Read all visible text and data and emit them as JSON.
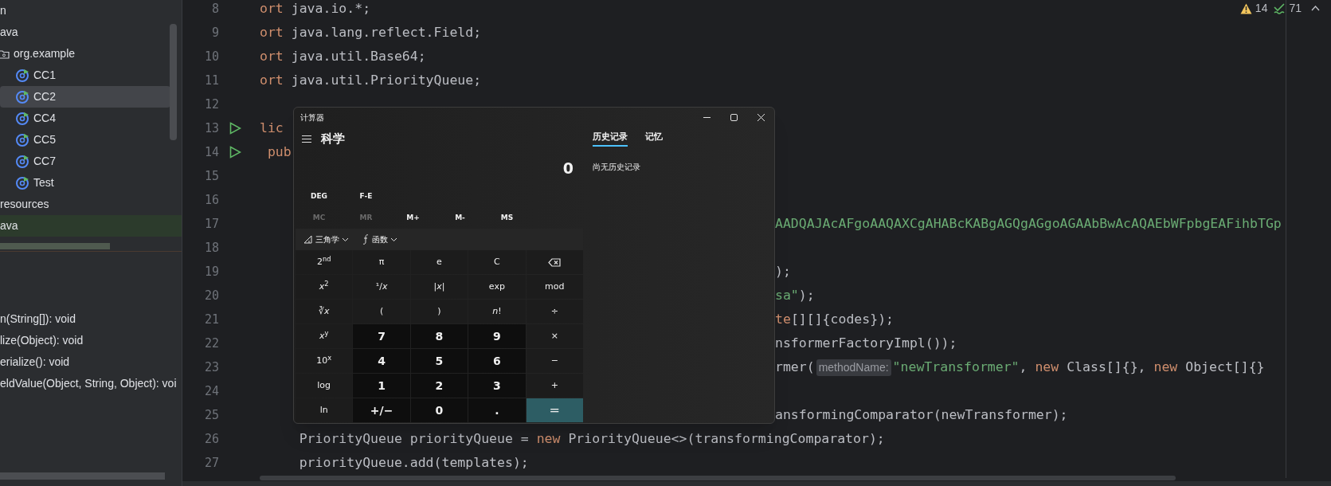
{
  "project_tree": [
    {
      "label": "n",
      "highlighted": false
    },
    {
      "label": "ava",
      "highlighted": false,
      "children": [
        {
          "label": "org.example",
          "kind": "package",
          "children": [
            {
              "label": "CC1",
              "kind": "class",
              "selected": false
            },
            {
              "label": "CC2",
              "kind": "class",
              "selected": true
            },
            {
              "label": "CC4",
              "kind": "class",
              "selected": false
            },
            {
              "label": "CC5",
              "kind": "class",
              "selected": false
            },
            {
              "label": "CC7",
              "kind": "class",
              "selected": false
            },
            {
              "label": "Test",
              "kind": "class",
              "selected": false
            }
          ]
        }
      ]
    },
    {
      "label": "resources",
      "highlighted": false
    },
    {
      "label": "ava",
      "highlighted": true
    }
  ],
  "structure": [
    "n(String[]): void",
    "lize(Object): void",
    "erialize(): void",
    "eldValue(Object, String, Object): voi"
  ],
  "inspections": {
    "warnings": "14",
    "passed": "71"
  },
  "code_lines": [
    {
      "number": "8",
      "kind": "full",
      "run": false,
      "segments": [
        {
          "t": "ort",
          "kind": "keyword"
        },
        {
          "t": " java.io.*;",
          "kind": "plain"
        }
      ]
    },
    {
      "number": "9",
      "kind": "full",
      "run": false,
      "segments": [
        {
          "t": "ort",
          "kind": "keyword"
        },
        {
          "t": " java.lang.reflect.Field;",
          "kind": "plain"
        }
      ]
    },
    {
      "number": "10",
      "kind": "full",
      "run": false,
      "segments": [
        {
          "t": "ort",
          "kind": "keyword"
        },
        {
          "t": " java.util.Base64;",
          "kind": "plain"
        }
      ]
    },
    {
      "number": "11",
      "kind": "full",
      "run": false,
      "segments": [
        {
          "t": "ort",
          "kind": "keyword"
        },
        {
          "t": " java.util.PriorityQueue;",
          "kind": "plain"
        }
      ]
    },
    {
      "number": "12",
      "run": false
    },
    {
      "number": "13",
      "kind": "full",
      "run": true,
      "segments": [
        {
          "t": "lic",
          "kind": "keyword"
        }
      ]
    },
    {
      "number": "14",
      "kind": "full",
      "run": true,
      "segments": [
        {
          "t": " pub",
          "kind": "keyword"
        }
      ]
    },
    {
      "number": "15",
      "run": false
    },
    {
      "number": "16",
      "run": false
    },
    {
      "number": "17",
      "kind": "tail",
      "run": false,
      "segments": [
        {
          "t": "AADQAJAcAFgoAAQAXCgAHABcKABgAGQgAGgoAGAAbBwAcAQAEbWFpbgEAFihbTGp",
          "kind": "string"
        }
      ]
    },
    {
      "number": "18",
      "run": false
    },
    {
      "number": "19",
      "kind": "tail",
      "run": false,
      "segments": [
        {
          "t": ");",
          "kind": "plain"
        }
      ]
    },
    {
      "number": "20",
      "kind": "tail",
      "run": false,
      "segments": [
        {
          "t": "sa\"",
          "kind": "string"
        },
        {
          "t": ");",
          "kind": "plain"
        }
      ]
    },
    {
      "number": "21",
      "kind": "tail",
      "run": false,
      "segments": [
        {
          "t": "te",
          "kind": "keyword"
        },
        {
          "t": "[][]{codes});",
          "kind": "plain"
        }
      ]
    },
    {
      "number": "22",
      "kind": "tail",
      "run": false,
      "segments": [
        {
          "t": "nsformerFactoryImpl());",
          "kind": "plain"
        }
      ]
    },
    {
      "number": "23",
      "kind": "tail",
      "run": false,
      "segments": [
        {
          "t": "rmer(",
          "kind": "plain"
        },
        {
          "t": "methodName:",
          "kind": "hint"
        },
        {
          "t": "\"newTransformer\"",
          "kind": "string"
        },
        {
          "t": ", ",
          "kind": "plain"
        },
        {
          "t": "new",
          "kind": "keyword"
        },
        {
          "t": " Class[]{}, ",
          "kind": "plain"
        },
        {
          "t": "new",
          "kind": "keyword"
        },
        {
          "t": " Object[]{}",
          "kind": "plain"
        }
      ]
    },
    {
      "number": "24",
      "run": false
    },
    {
      "number": "25",
      "kind": "tail",
      "run": false,
      "segments": [
        {
          "t": "ansformingComparator(newTransformer);",
          "kind": "plain"
        }
      ]
    },
    {
      "number": "26",
      "kind": "full",
      "run": false,
      "segments": [
        {
          "t": "     PriorityQueue priorityQueue = ",
          "kind": "plain"
        },
        {
          "t": "new",
          "kind": "keyword"
        },
        {
          "t": " PriorityQueue<>(transformingComparator);",
          "kind": "plain"
        }
      ]
    },
    {
      "number": "27",
      "kind": "full",
      "run": false,
      "segments": [
        {
          "t": "     priorityQueue.add(templates);",
          "kind": "plain"
        }
      ]
    }
  ],
  "calculator": {
    "title": "计算器",
    "mode": "科学",
    "tabs": [
      {
        "label": "历史记录",
        "selected": true
      },
      {
        "label": "记忆",
        "selected": false
      }
    ],
    "display": "0",
    "history_empty": "尚无历史记录",
    "settings": [
      "DEG",
      "F-E"
    ],
    "memory": [
      {
        "label": "MC",
        "disabled": true
      },
      {
        "label": "MR",
        "disabled": true
      },
      {
        "label": "M+",
        "disabled": false
      },
      {
        "label": "M-",
        "disabled": false
      },
      {
        "label": "MS",
        "disabled": false
      }
    ],
    "menus": [
      {
        "label": "三角学",
        "kind": "trig"
      },
      {
        "label": "函数",
        "kind": "function"
      }
    ],
    "keys": [
      {
        "label": "2$^{nd}$",
        "kind": "fn"
      },
      {
        "label": "π",
        "kind": "fn"
      },
      {
        "label": "e",
        "kind": "fn"
      },
      {
        "label": "C",
        "kind": "fn"
      },
      {
        "kind": "backspace"
      },
      {
        "label": "*x*$^{2}$",
        "kind": "fn"
      },
      {
        "label": "¹/*x*",
        "kind": "fn"
      },
      {
        "label": "|*x*|",
        "kind": "fn"
      },
      {
        "label": "exp",
        "kind": "fn"
      },
      {
        "label": "mod",
        "kind": "fn"
      },
      {
        "label": "∛*x*",
        "kind": "fn"
      },
      {
        "label": "(",
        "kind": "fn"
      },
      {
        "label": ")",
        "kind": "fn"
      },
      {
        "label": "*n*!",
        "kind": "fn"
      },
      {
        "label": "÷",
        "kind": "fn"
      },
      {
        "label": "*x*$^{y}$",
        "kind": "fn"
      },
      {
        "label": "7",
        "kind": "num"
      },
      {
        "label": "8",
        "kind": "num"
      },
      {
        "label": "9",
        "kind": "num"
      },
      {
        "label": "×",
        "kind": "fn"
      },
      {
        "label": "10$^{x}$",
        "kind": "fn"
      },
      {
        "label": "4",
        "kind": "num"
      },
      {
        "label": "5",
        "kind": "num"
      },
      {
        "label": "6",
        "kind": "num"
      },
      {
        "label": "−",
        "kind": "fn"
      },
      {
        "label": "log",
        "kind": "fn"
      },
      {
        "label": "1",
        "kind": "num"
      },
      {
        "label": "2",
        "kind": "num"
      },
      {
        "label": "3",
        "kind": "num"
      },
      {
        "label": "+",
        "kind": "fn"
      },
      {
        "label": "ln",
        "kind": "fn"
      },
      {
        "label": "+/−",
        "kind": "num"
      },
      {
        "label": "0",
        "kind": "num"
      },
      {
        "label": ".",
        "kind": "num"
      },
      {
        "label": "=",
        "kind": "equals"
      }
    ]
  }
}
